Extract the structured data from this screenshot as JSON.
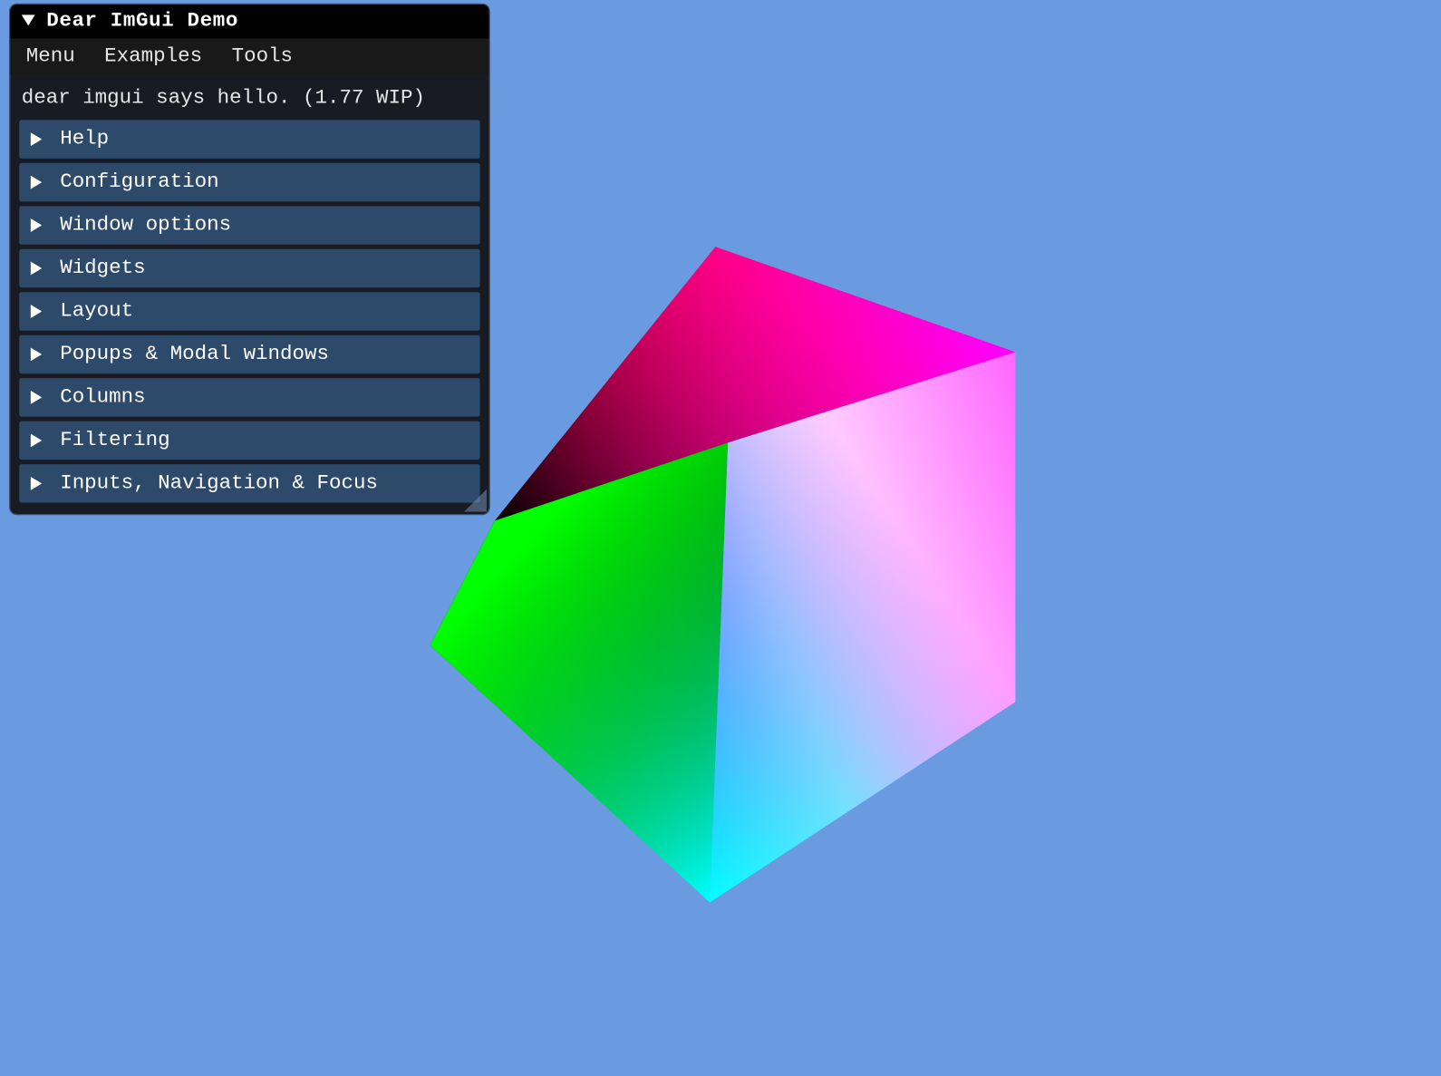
{
  "window": {
    "title": "Dear ImGui Demo"
  },
  "menubar": {
    "items": [
      {
        "label": "Menu"
      },
      {
        "label": "Examples"
      },
      {
        "label": "Tools"
      }
    ]
  },
  "hello_text": "dear imgui says hello. (1.77 WIP)",
  "sections": [
    {
      "label": "Help"
    },
    {
      "label": "Configuration"
    },
    {
      "label": "Window options"
    },
    {
      "label": "Widgets"
    },
    {
      "label": "Layout"
    },
    {
      "label": "Popups & Modal windows"
    },
    {
      "label": "Columns"
    },
    {
      "label": "Filtering"
    },
    {
      "label": "Inputs, Navigation & Focus"
    }
  ],
  "colors": {
    "background": "#6a9be0",
    "window_bg": "rgba(17,17,17,0.92)",
    "header_bg": "#2d4a6b"
  }
}
